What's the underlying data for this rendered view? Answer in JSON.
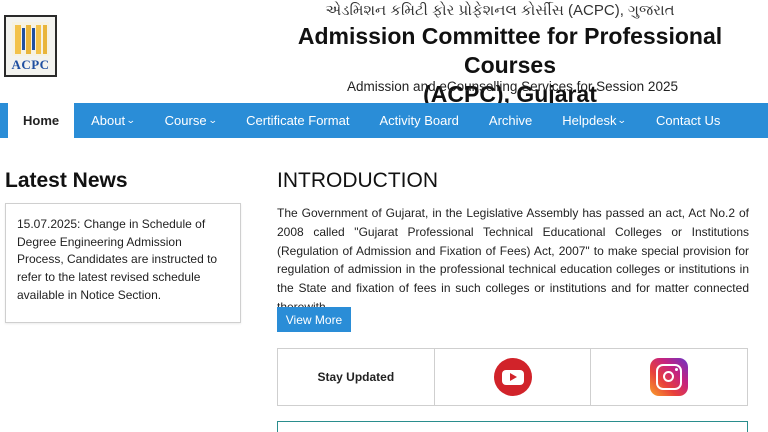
{
  "header": {
    "logo_text": "ACPC",
    "gujarati_title": "એડમિશન કમિટી ફોર પ્રોફેશનલ કોર્સીસ (ACPC), ગુજરાત",
    "title_line1": "Admission Committee for Professional Courses",
    "title_line2": "(ACPC), Gujarat",
    "subtitle": "Admission and eCounselling Services for Session 2025"
  },
  "nav": {
    "items": [
      {
        "label": "Home",
        "active": true,
        "dropdown": false
      },
      {
        "label": "About",
        "active": false,
        "dropdown": true
      },
      {
        "label": "Course",
        "active": false,
        "dropdown": true
      },
      {
        "label": "Certificate Format",
        "active": false,
        "dropdown": false
      },
      {
        "label": "Activity Board",
        "active": false,
        "dropdown": false
      },
      {
        "label": "Archive",
        "active": false,
        "dropdown": false
      },
      {
        "label": "Helpdesk",
        "active": false,
        "dropdown": true
      },
      {
        "label": "Contact Us",
        "active": false,
        "dropdown": false
      }
    ],
    "chevron_glyph": "⌄"
  },
  "latest_news": {
    "heading": "Latest News",
    "items": [
      "15.07.2025: Change in Schedule of Degree Engineering Admission Process, Candidates are instructed to refer to the latest revised schedule available in Notice Section."
    ]
  },
  "intro": {
    "heading": "INTRODUCTION",
    "body": "The Government of Gujarat, in the Legislative Assembly has passed an act, Act No.2 of 2008 called \"Gujarat Professional Technical Educational Colleges or Institutions (Regulation of Admission and Fixation of Fees) Act, 2007\" to make special provision for regulation of admission in the professional technical education colleges or institutions in the State and fixation of fees in such colleges or institutions and for matter connected therewith.",
    "button_label": "View More"
  },
  "social": {
    "label": "Stay Updated",
    "icons": [
      "youtube-icon",
      "instagram-icon"
    ]
  },
  "colors": {
    "nav_bg": "#2a8dd7",
    "youtube": "#d1232a",
    "logo_text": "#1f4fa0"
  }
}
